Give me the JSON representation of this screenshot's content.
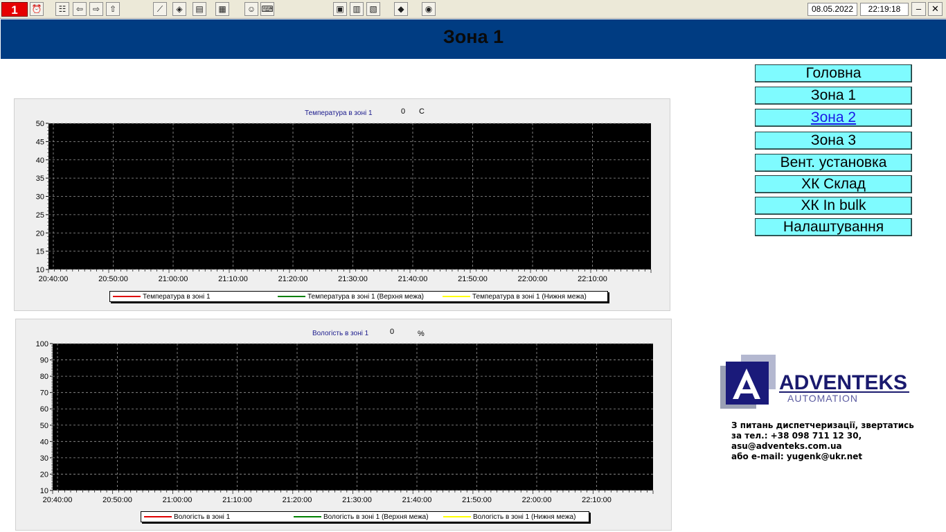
{
  "toolbar": {
    "window_number": "1",
    "date": "08.05.2022",
    "time": "22:19:18",
    "minimize_label": "–",
    "close_label": "✕",
    "icons": [
      "alarm-clock-icon",
      "tree-icon",
      "arrow-left-icon",
      "arrow-right-icon",
      "arrow-up-icon",
      "trend-icon",
      "print-icon",
      "document-icon",
      "report-icon",
      "users-icon",
      "keyboard-icon",
      "screen1-icon",
      "screen2-icon",
      "screen3-icon",
      "eraser-icon",
      "book-icon"
    ]
  },
  "header": {
    "title": "Зона 1"
  },
  "temp_chart": {
    "title": "Температура в зоні 1",
    "current_value": "0",
    "unit": "C",
    "legend": [
      "Температура в зоні 1",
      "Температура в зоні 1 (Верхня межа)",
      "Температура в зоні 1 (Нижня межа)"
    ],
    "legend_colors": [
      "#e00000",
      "#008000",
      "#ffff00"
    ]
  },
  "hum_chart": {
    "title": "Вологість в зоні 1",
    "current_value": "0",
    "unit": "%",
    "legend": [
      "Вологість в зоні 1",
      "Вологість в зоні 1 (Верхня межа)",
      "Вологість в зоні 1 (Нижня межа)"
    ],
    "legend_colors": [
      "#e00000",
      "#008000",
      "#ffff00"
    ]
  },
  "chart_data": [
    {
      "type": "line",
      "title": "Температура в зоні 1",
      "ylim": [
        10,
        50
      ],
      "y_ticks": [
        "50",
        "45",
        "40",
        "35",
        "30",
        "25",
        "20",
        "15",
        "10"
      ],
      "x_ticks": [
        "20:40:00",
        "20:50:00",
        "21:00:00",
        "21:10:00",
        "21:20:00",
        "21:30:00",
        "21:40:00",
        "21:50:00",
        "22:00:00",
        "22:10:00"
      ],
      "grid": true,
      "background": "#000000",
      "series": [
        {
          "name": "Температура в зоні 1",
          "values": []
        },
        {
          "name": "Температура в зоні 1 (Верхня межа)",
          "values": []
        },
        {
          "name": "Температура в зоні 1 (Нижня межа)",
          "values": []
        }
      ]
    },
    {
      "type": "line",
      "title": "Вологість в зоні 1",
      "ylim": [
        10,
        100
      ],
      "y_ticks": [
        "100",
        "90",
        "80",
        "70",
        "60",
        "50",
        "40",
        "30",
        "20",
        "10"
      ],
      "x_ticks": [
        "20:40:00",
        "20:50:00",
        "21:00:00",
        "21:10:00",
        "21:20:00",
        "21:30:00",
        "21:40:00",
        "21:50:00",
        "22:00:00",
        "22:10:00"
      ],
      "grid": true,
      "background": "#000000",
      "series": [
        {
          "name": "Вологість в зоні 1",
          "values": []
        },
        {
          "name": "Вологість в зоні 1 (Верхня межа)",
          "values": []
        },
        {
          "name": "Вологість в зоні 1 (Нижня межа)",
          "values": []
        }
      ]
    }
  ],
  "nav": [
    {
      "label": "Головна"
    },
    {
      "label": "Зона 1"
    },
    {
      "label": "Зона 2"
    },
    {
      "label": "Зона 3"
    },
    {
      "label": "Вент. установка"
    },
    {
      "label": "ХК Склад"
    },
    {
      "label": "ХК In bulk"
    },
    {
      "label": "Налаштування"
    }
  ],
  "logo": {
    "brand": "ADVENTEKS",
    "tagline": "AUTOMATION",
    "colors": [
      "#1a1a6e",
      "#5a5aa0"
    ]
  },
  "contact": {
    "line1": "З питань диспетчеризації, звертатись",
    "line2": "за тел.: +38 098 711 12 30,",
    "line3": "asu@adventeks.com.ua",
    "line4": "або e-mail: yugenk@ukr.net"
  }
}
